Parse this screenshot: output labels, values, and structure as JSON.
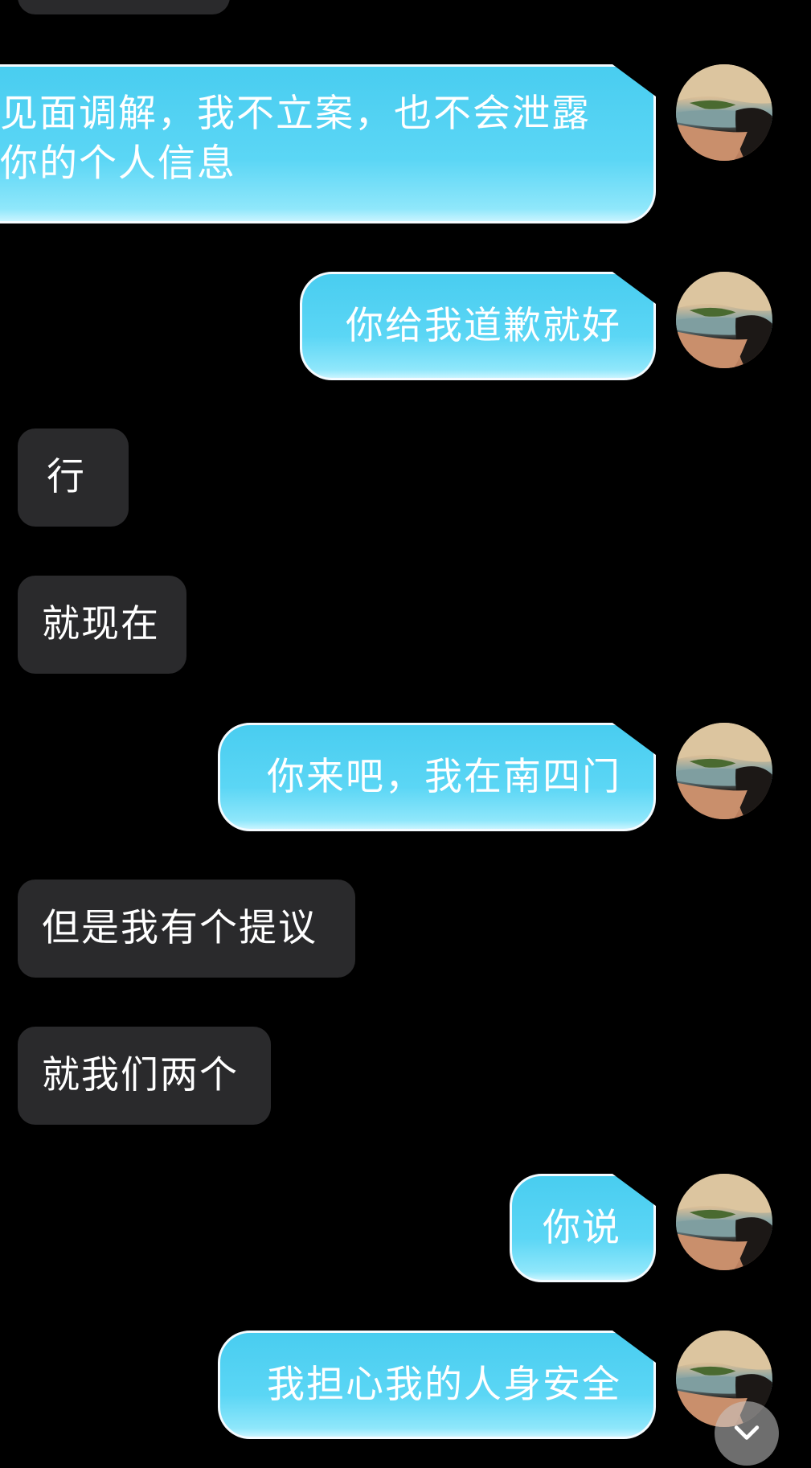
{
  "conversation": {
    "messages": [
      {
        "side": "out",
        "lines": [
          "见面调解，我不立案，也不会泄露",
          "你的个人信息"
        ]
      },
      {
        "side": "out",
        "text": "你给我道歉就好"
      },
      {
        "side": "in",
        "text": "行"
      },
      {
        "side": "in",
        "text": "就现在"
      },
      {
        "side": "out",
        "text": "你来吧，我在南四门"
      },
      {
        "side": "in",
        "text": "但是我有个提议"
      },
      {
        "side": "in",
        "text": "就我们两个"
      },
      {
        "side": "out",
        "text": "你说"
      },
      {
        "side": "out",
        "text": "我担心我的人身安全"
      }
    ]
  },
  "colors": {
    "background": "#000000",
    "incoming_bubble": "#2a2a2c",
    "outgoing_bubble": "#5bd6f5",
    "text": "#ffffff"
  },
  "icons": {
    "scroll_down": "chevron-down-icon",
    "avatar": "landscape-avatar"
  }
}
